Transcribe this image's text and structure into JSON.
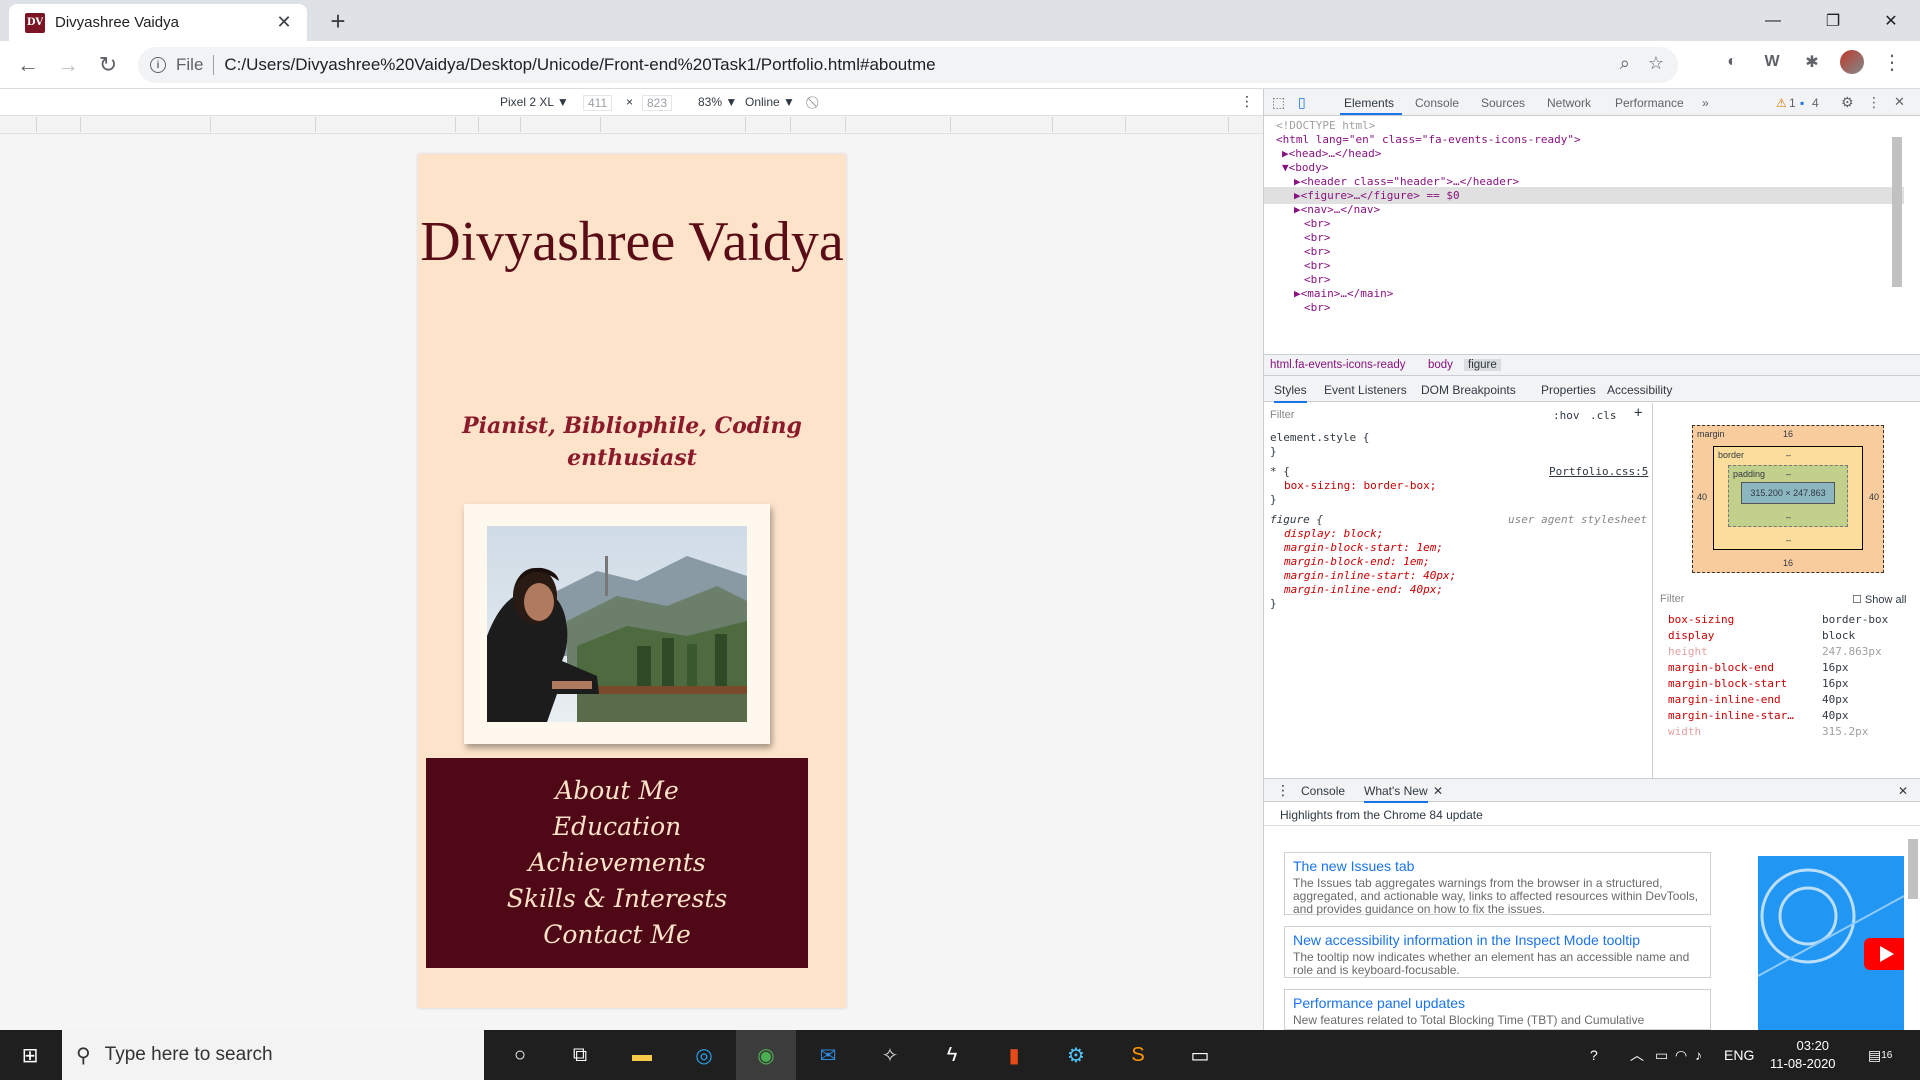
{
  "tab": {
    "favicon": "DV",
    "title": "Divyashree Vaidya",
    "close": "✕"
  },
  "toolbar": {
    "scheme": "File",
    "url": "C:/Users/Divyashree%20Vaidya/Desktop/Unicode/Front-end%20Task1/Portfolio.html#aboutme"
  },
  "device": {
    "model": "Pixel 2 XL ▼",
    "width": "411",
    "x": "×",
    "height": "823",
    "zoom": "83% ▼",
    "network": "Online ▼"
  },
  "page": {
    "name": "Divyashree Vaidya",
    "tagline": "Pianist, Bibliophile, Coding enthusiast",
    "nav": [
      "About Me",
      "Education",
      "Achievements",
      "Skills & Interests",
      "Contact Me"
    ]
  },
  "devtools": {
    "tabs": [
      "Elements",
      "Console",
      "Sources",
      "Network",
      "Performance"
    ],
    "warnings": "1",
    "messages": "4",
    "dom": [
      "<!DOCTYPE html>",
      "<html lang=\"en\" class=\"fa-events-icons-ready\">",
      "▶<head>…</head>",
      "▼<body>",
      "▶<header class=\"header\">…</header>",
      "▶<figure>…</figure> == $0",
      "▶<nav>…</nav>",
      "<br>",
      "<br>",
      "<br>",
      "<br>",
      "<br>",
      "▶<main>…</main>",
      "<br>"
    ],
    "breadcrumbs": [
      "html.fa-events-icons-ready",
      "body",
      "figure"
    ],
    "subtabs": [
      "Styles",
      "Event Listeners",
      "DOM Breakpoints",
      "Properties",
      "Accessibility"
    ],
    "filter": "Filter",
    "hov": ":hov",
    "cls": ".cls",
    "styles": {
      "element_style": "element.style {",
      "close": "}",
      "universal_sel": "* {",
      "universal_src": "Portfolio.css:5",
      "box_sizing": "box-sizing: border-box;",
      "figure_sel": "figure {",
      "figure_src": "user agent stylesheet",
      "figure_rules": [
        "display: block;",
        "margin-block-start: 1em;",
        "margin-block-end: 1em;",
        "margin-inline-start: 40px;",
        "margin-inline-end: 40px;"
      ]
    },
    "boxmodel": {
      "margin": "margin",
      "border": "border",
      "padding": "padding",
      "content": "315.200 × 247.863",
      "top": "16",
      "bottom": "16",
      "left": "40",
      "right": "40",
      "dash": "–"
    },
    "computed_filter": "Filter",
    "show_all": "Show all",
    "computed": [
      {
        "k": "box-sizing",
        "v": "border-box"
      },
      {
        "k": "display",
        "v": "block"
      },
      {
        "k": "height",
        "v": "247.863px"
      },
      {
        "k": "margin-block-end",
        "v": "16px"
      },
      {
        "k": "margin-block-start",
        "v": "16px"
      },
      {
        "k": "margin-inline-end",
        "v": "40px"
      },
      {
        "k": "margin-inline-star…",
        "v": "40px"
      },
      {
        "k": "width",
        "v": "315.2px"
      }
    ],
    "drawer_tabs": [
      "Console",
      "What's New"
    ],
    "whatsnew_header": "Highlights from the Chrome 84 update",
    "cards": [
      {
        "title": "The new Issues tab",
        "body": "The Issues tab aggregates warnings from the browser in a structured, aggregated, and actionable way, links to affected resources within DevTools, and provides guidance on how to fix the issues."
      },
      {
        "title": "New accessibility information in the Inspect Mode tooltip",
        "body": "The tooltip now indicates whether an element has an accessible name and role and is keyboard-focusable."
      },
      {
        "title": "Performance panel updates",
        "body": "New features related to Total Blocking Time (TBT) and Cumulative"
      }
    ]
  },
  "taskbar": {
    "search_placeholder": "Type here to search",
    "lang": "ENG",
    "time": "03:20",
    "date": "11-08-2020",
    "notifications": "16"
  }
}
